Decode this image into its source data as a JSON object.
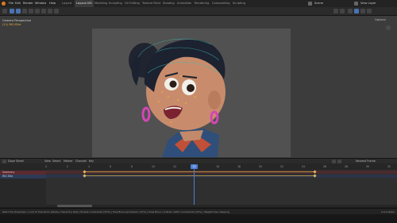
{
  "topbar": {
    "menus": [
      "File",
      "Edit",
      "Render",
      "Window",
      "Help"
    ],
    "workspaces": [
      "Layout",
      "Layout.001",
      "Modeling",
      "Sculpting",
      "UV Editing",
      "Texture Paint",
      "Shading",
      "Animation",
      "Rendering",
      "Compositing",
      "Scripting"
    ],
    "active_workspace": "Layout.001",
    "scene_label": "Scene",
    "view_layer_label": "View Layer"
  },
  "viewport": {
    "camera_title": "Camera Perspective",
    "camera_subtitle": "(11) RIG Ellie",
    "options_label": "Options"
  },
  "timeline": {
    "mode": "Dope Sheet",
    "menus": [
      "View",
      "Select",
      "Marker",
      "Channel",
      "Key"
    ],
    "summary_label": "Summary",
    "track_label": "RIG Ellie",
    "interpolation": "Nearest Frame",
    "current_frame": "11",
    "ticks": [
      "0",
      "2",
      "4",
      "6",
      "8",
      "10",
      "12",
      "14",
      "16",
      "18",
      "20",
      "22",
      "24",
      "26",
      "28",
      "30",
      "32"
    ]
  },
  "status": {
    "text": "Weird Tip Dropdown  |  Lock to Transform (Pixels | Hierarchy Opt)  |  Enable constraints (25%)  |  Free Bone permission (12%)  |  Pose Bone  |  Collider 100% constraints (12%)  |  Weight tree mapping",
    "version": "2.9.0 Alpha"
  },
  "colors": {
    "accent": "#4a72b0",
    "summary_row": "#5a2a30",
    "track_row": "#2c3a55",
    "playhead": "#4d80d6",
    "keyframe": "#e0b860"
  }
}
